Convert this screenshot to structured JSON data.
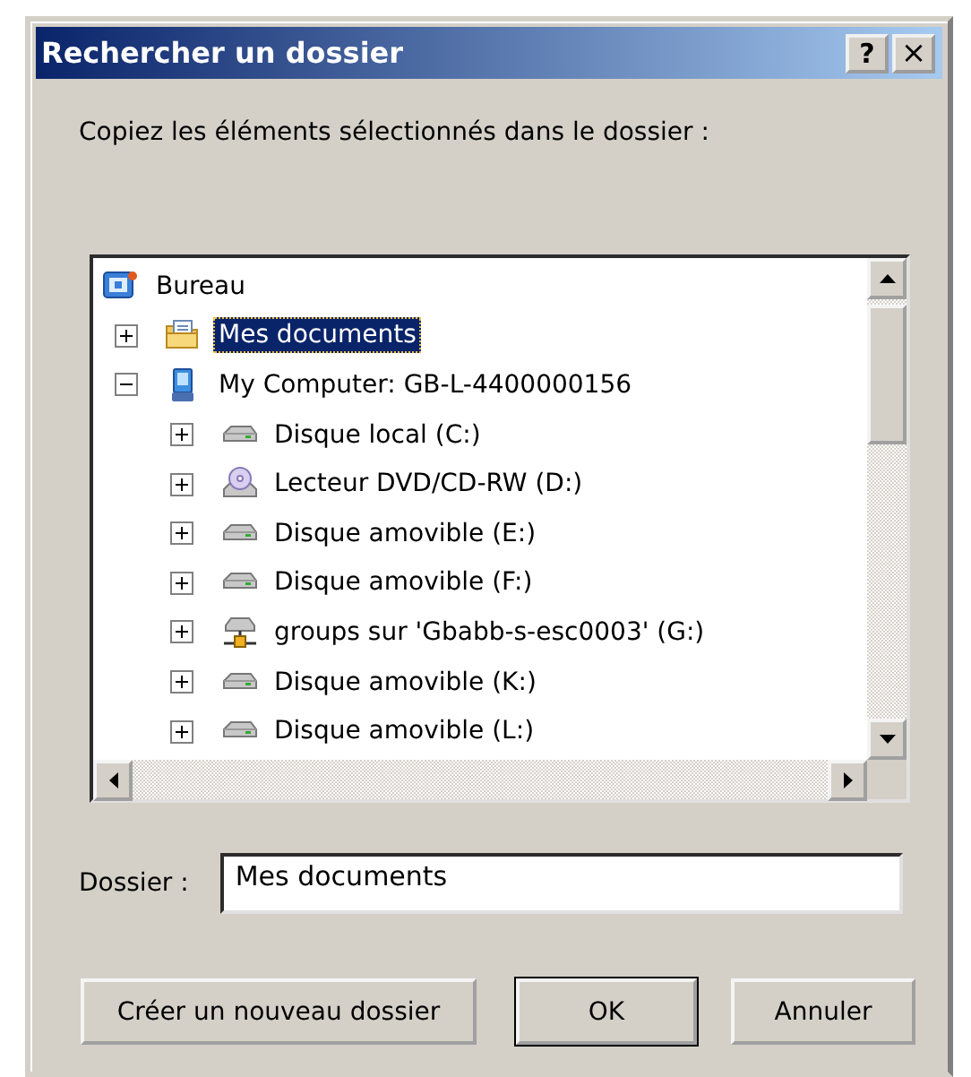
{
  "window": {
    "title": "Rechercher un dossier",
    "controls": [
      {
        "kind": "help",
        "label": "?"
      },
      {
        "kind": "close",
        "label": "×"
      }
    ]
  },
  "prompt": "Copiez les éléments sélectionnés dans le dossier :",
  "tree": [
    {
      "label": "Bureau",
      "kind": "desktop",
      "selected": false,
      "children": [
        {
          "label": "Mes documents",
          "kind": "documents",
          "selected": true,
          "expanded": false
        },
        {
          "label": "My Computer: GB-L-4400000156",
          "kind": "computer",
          "selected": false,
          "expanded": true,
          "children": [
            {
              "label": "Disque local (C:)",
              "kind": "disk",
              "selected": false,
              "expanded": false
            },
            {
              "label": "Lecteur DVD/CD-RW (D:)",
              "kind": "cdrom",
              "selected": false,
              "expanded": false
            },
            {
              "label": "Disque amovible (E:)",
              "kind": "disk",
              "selected": false,
              "expanded": false
            },
            {
              "label": "Disque amovible (F:)",
              "kind": "disk",
              "selected": false,
              "expanded": false
            },
            {
              "label": "groups sur 'Gbabb-s-esc0003' (G:)",
              "kind": "network",
              "selected": false,
              "expanded": false
            },
            {
              "label": "Disque amovible (K:)",
              "kind": "disk",
              "selected": false,
              "expanded": false
            },
            {
              "label": "Disque amovible (L:)",
              "kind": "disk",
              "selected": false,
              "expanded": false
            }
          ]
        }
      ]
    }
  ],
  "folder_field": {
    "label": "Dossier :",
    "value": "Mes documents"
  },
  "buttons": [
    {
      "label": "Créer un nouveau dossier",
      "default": false
    },
    {
      "label": "OK",
      "default": true
    },
    {
      "label": "Annuler",
      "default": false
    }
  ]
}
